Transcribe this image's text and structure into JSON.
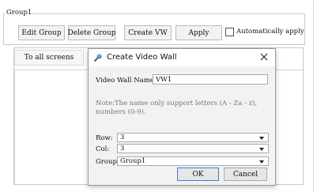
{
  "group_box": {
    "title": "Group1"
  },
  "toolbar": {
    "edit_group": "Edit Group",
    "delete_group": "Delete Group",
    "create_vw": "Create VW",
    "apply": "Apply",
    "auto_apply_label": "Automatically apply"
  },
  "to_all_screens": "To all screens",
  "dialog": {
    "title": "Create Video Wall",
    "name_label": "Video Wall Name:",
    "name_value": "VW1",
    "note": "Note:The name only support letters (A - Za - z), numbers (0-9).",
    "row_label": "Row:",
    "row_value": "3",
    "col_label": "Col:",
    "col_value": "3",
    "group_label": "Group:",
    "group_value": "Group1",
    "ok": "OK",
    "cancel": "Cancel"
  }
}
